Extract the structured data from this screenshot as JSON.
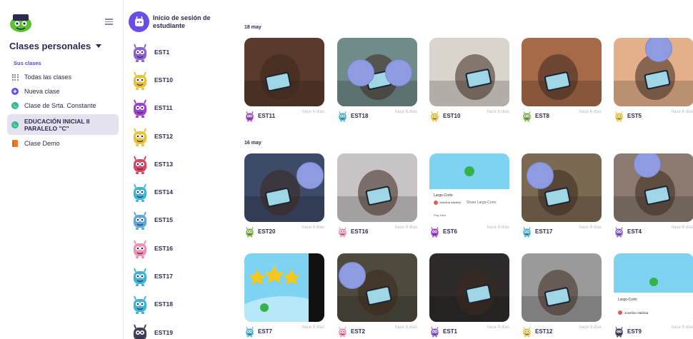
{
  "sidebar": {
    "class_selector": "Clases personales",
    "section_label": "Sus clases",
    "items": [
      {
        "label": "Todas las clases",
        "icon": "grid-icon",
        "color": "#8b89a6"
      },
      {
        "label": "Nueva clase",
        "icon": "plus-circle-icon",
        "color": "#6a4de8"
      },
      {
        "label": "Clase de Srta. Constante",
        "icon": "globe-icon",
        "color": "#27b6a8"
      },
      {
        "label": "EDUCACIÓN INICIAL II PARALELO \"C\"",
        "icon": "globe-icon",
        "color": "#27b6a8",
        "active": true
      },
      {
        "label": "Clase Demo",
        "icon": "book-icon",
        "color": "#f07a24"
      }
    ]
  },
  "students": {
    "header": "Inicio de sesión de estudiante",
    "list": [
      {
        "name": "EST1",
        "color": "#8b5fd6"
      },
      {
        "name": "EST10",
        "color": "#e8c33a"
      },
      {
        "name": "EST11",
        "color": "#a23fd1"
      },
      {
        "name": "EST12",
        "color": "#e8c33a"
      },
      {
        "name": "EST13",
        "color": "#d84860"
      },
      {
        "name": "EST14",
        "color": "#3fb5d6"
      },
      {
        "name": "EST15",
        "color": "#5aa7d8"
      },
      {
        "name": "EST16",
        "color": "#f28fb2"
      },
      {
        "name": "EST17",
        "color": "#3fb5d6"
      },
      {
        "name": "EST18",
        "color": "#3fb5d6"
      },
      {
        "name": "EST19",
        "color": "#3f3f55"
      }
    ]
  },
  "feed": {
    "groups": [
      {
        "date": "18 may",
        "posts": [
          {
            "student": "EST11",
            "time": "hace 6 días",
            "color": "#a23fd1",
            "photo": "#5a3a2c"
          },
          {
            "student": "EST18",
            "time": "hace 6 días",
            "color": "#3fb5d6",
            "photo": "#6f8c8a"
          },
          {
            "student": "EST10",
            "time": "hace 6 días",
            "color": "#e8c33a",
            "photo": "#d9d4cc"
          },
          {
            "student": "EST8",
            "time": "hace 6 días",
            "color": "#7ab640",
            "photo": "#a66a48"
          },
          {
            "student": "EST5",
            "time": "hace 6 días",
            "color": "#e8c33a",
            "photo": "#e4b08a"
          }
        ]
      },
      {
        "date": "16 may",
        "posts": [
          {
            "student": "EST20",
            "time": "hace 9 días",
            "color": "#7ab640",
            "photo": "#3d4a68"
          },
          {
            "student": "EST16",
            "time": "hace 9 días",
            "color": "#f28fb2",
            "photo": "#c8c4c6"
          },
          {
            "student": "EST6",
            "time": "hace 9 días",
            "color": "#a23fd1",
            "photo": "#e9f3f0"
          },
          {
            "student": "EST17",
            "time": "hace 9 días",
            "color": "#3fb5d6",
            "photo": "#7a6a52"
          },
          {
            "student": "EST4",
            "time": "hace 9 días",
            "color": "#8b5fd6",
            "photo": "#8a7a70"
          }
        ]
      },
      {
        "date": "",
        "posts": [
          {
            "student": "EST7",
            "time": "hace 9 días",
            "color": "#3fb5d6",
            "photo": "#7fd3f2"
          },
          {
            "student": "EST2",
            "time": "hace 9 días",
            "color": "#f28fb2",
            "photo": "#4e4a3e"
          },
          {
            "student": "EST1",
            "time": "hace 9 días",
            "color": "#8b5fd6",
            "photo": "#2e2a2a"
          },
          {
            "student": "EST12",
            "time": "hace 9 días",
            "color": "#e8c33a",
            "photo": "#9a9a9a"
          },
          {
            "student": "EST9",
            "time": "hace 9 días",
            "color": "#3f3f55",
            "photo": "#7fd3f2"
          }
        ]
      }
    ],
    "screenshot_text": {
      "header": "Largo-Corto",
      "author": "Josefina Valdivia",
      "shared": "Play Next",
      "title": "Share Largo-Corto"
    }
  }
}
